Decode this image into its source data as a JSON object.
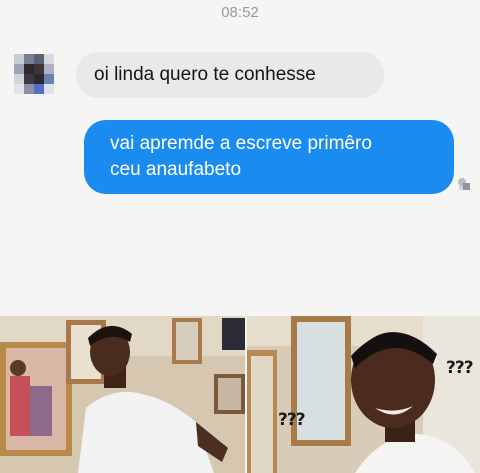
{
  "status_bar": {
    "time": "08:52"
  },
  "conversation": {
    "incoming": {
      "text": "oi linda quero te conhesse"
    },
    "outgoing": {
      "lines": [
        "vai apremde a escreve primêro",
        "ceu anaufabeto"
      ]
    }
  },
  "meme": {
    "left_caption": "???",
    "right_caption": "???"
  },
  "colors": {
    "outgoing_bubble": "#1a8cf0",
    "incoming_bubble": "#e9e9e9",
    "chat_background": "#f5f5f3"
  },
  "icons": [
    "blurred-avatar-icon",
    "read-receipt-icon"
  ]
}
